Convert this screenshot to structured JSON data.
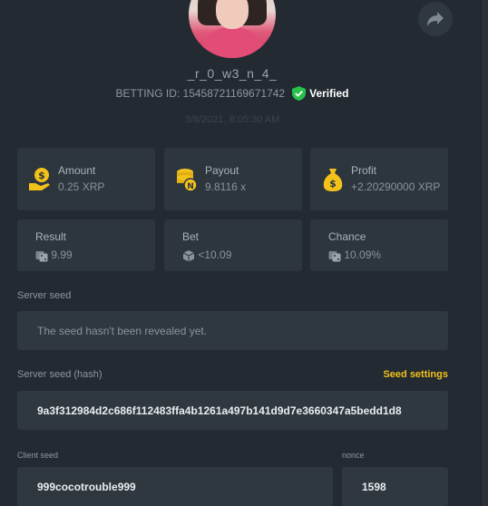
{
  "profile": {
    "username": "_r_0_w3_n_4_",
    "betting_id": "BETTING ID: 15458721169671742",
    "verified_label": "Verified",
    "timestamp": "3/8/2021, 8:05:30 AM"
  },
  "stats": {
    "amount": {
      "label": "Amount",
      "value": "0.25 XRP"
    },
    "payout": {
      "label": "Payout",
      "value": "9.8116 x"
    },
    "profit": {
      "label": "Profit",
      "value": "+2.20290000 XRP"
    },
    "result": {
      "label": "Result",
      "value": "9.99"
    },
    "bet": {
      "label": "Bet",
      "value": "<10.09"
    },
    "chance": {
      "label": "Chance",
      "value": "10.09%"
    }
  },
  "server_seed": {
    "label": "Server seed",
    "value": "The seed hasn't been revealed yet."
  },
  "server_seed_hash": {
    "label": "Server seed (hash)",
    "settings_link": "Seed settings",
    "value": "9a3f312984d2c686f112483ffa4b1261a497b141d9d7e3660347a5bedd1d8"
  },
  "client_seed": {
    "label": "Client seed",
    "value": "999cocotrouble999"
  },
  "nonce": {
    "label": "nonce",
    "value": "1598"
  },
  "colors": {
    "background": "#232a31",
    "card": "#2d353d",
    "accent_yellow": "#f2c21b",
    "verified_green": "#27c24c",
    "profit_text": "#8a939c"
  },
  "icons": {
    "share": "share-icon",
    "verified": "shield-check-icon",
    "amount": "hand-coin-icon",
    "payout": "coin-stack-icon",
    "profit": "money-bag-icon",
    "result": "dice-icon",
    "bet": "cube-icon",
    "chance": "dice-icon"
  }
}
